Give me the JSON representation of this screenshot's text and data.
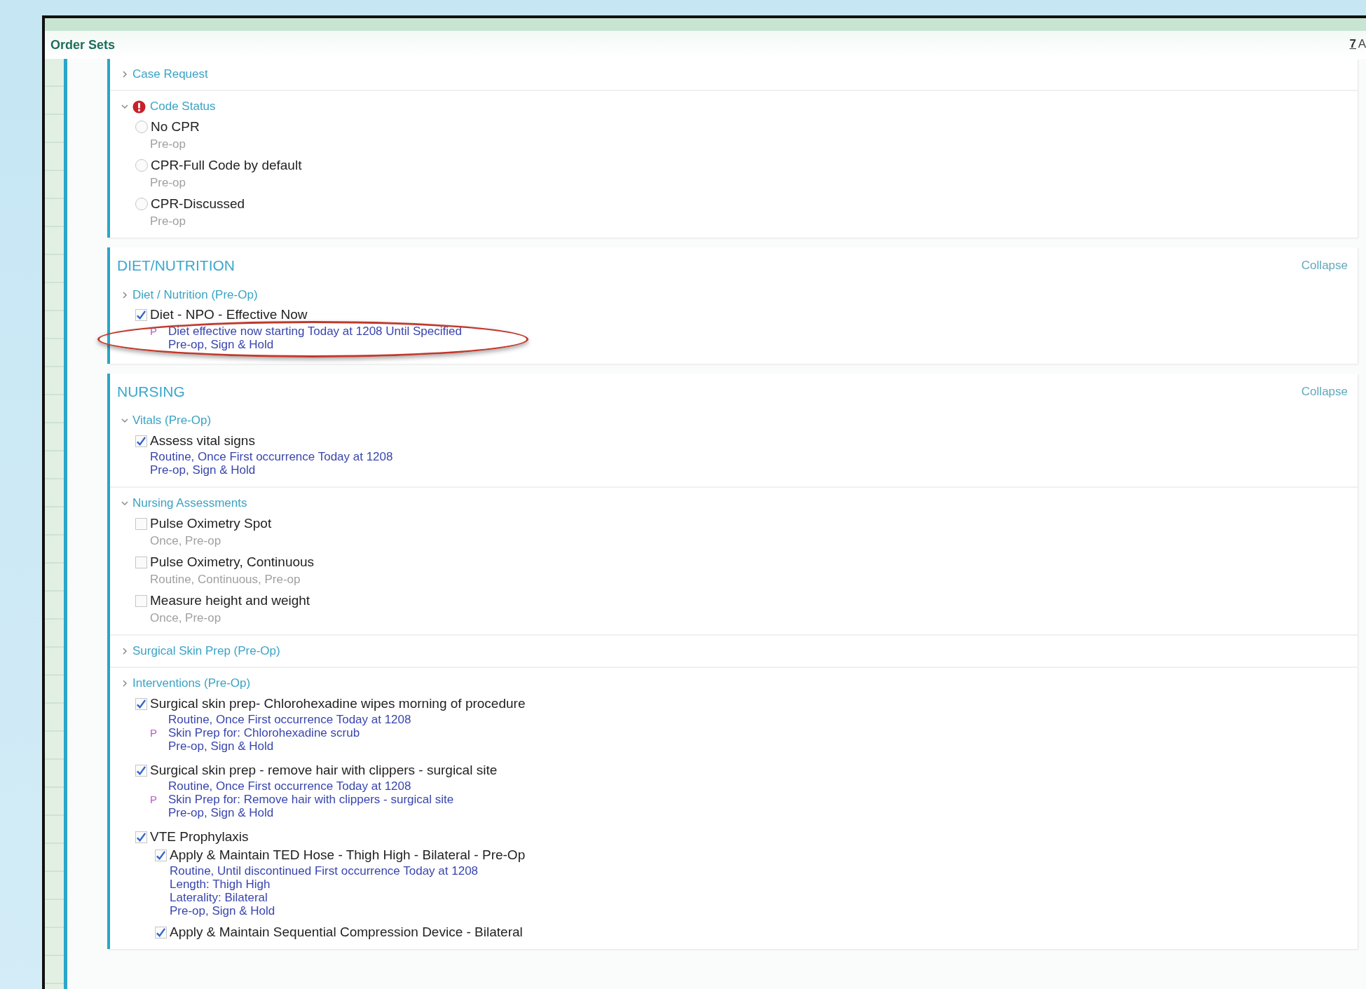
{
  "window": {
    "title": "Order Sets",
    "help": "7",
    "cut_label": "A"
  },
  "sections": [
    {
      "groups": [
        {
          "title": "Case Request",
          "expanded": false
        },
        {
          "title": "Code Status",
          "expanded": true,
          "alert": true,
          "items": [
            {
              "kind": "radio",
              "label": "No CPR",
              "selected": false,
              "details": [
                {
                  "text": "Pre-op"
                }
              ]
            },
            {
              "kind": "radio",
              "label": "CPR-Full Code by default",
              "selected": false,
              "details": [
                {
                  "text": "Pre-op"
                }
              ]
            },
            {
              "kind": "radio",
              "label": "CPR-Discussed",
              "selected": false,
              "details": [
                {
                  "text": "Pre-op"
                }
              ]
            }
          ]
        }
      ]
    },
    {
      "title": "DIET/NUTRITION",
      "collapse": "Collapse",
      "groups": [
        {
          "title": "Diet / Nutrition (Pre-Op)",
          "expanded": false,
          "items": [
            {
              "kind": "checkbox",
              "label": "Diet - NPO - Effective Now",
              "checked": true,
              "highlighted": true,
              "details": [
                {
                  "text": "Diet effective now starting Today at 1208 Until Specified",
                  "flag": "P"
                },
                {
                  "text": "Pre-op, Sign & Hold"
                }
              ]
            }
          ]
        }
      ]
    },
    {
      "title": "NURSING",
      "collapse": "Collapse",
      "groups": [
        {
          "title": "Vitals (Pre-Op)",
          "expanded": true,
          "items": [
            {
              "kind": "checkbox",
              "label": "Assess vital signs",
              "checked": true,
              "details": [
                {
                  "text": "Routine, Once First occurrence Today at 1208"
                },
                {
                  "text": "Pre-op, Sign & Hold"
                }
              ]
            }
          ]
        },
        {
          "title": "Nursing Assessments",
          "expanded": true,
          "items": [
            {
              "kind": "checkbox",
              "label": "Pulse Oximetry Spot",
              "checked": false,
              "details": [
                {
                  "text": "Once, Pre-op"
                }
              ]
            },
            {
              "kind": "checkbox",
              "label": "Pulse Oximetry, Continuous",
              "checked": false,
              "details": [
                {
                  "text": "Routine, Continuous, Pre-op"
                }
              ]
            },
            {
              "kind": "checkbox",
              "label": "Measure height and weight",
              "checked": false,
              "details": [
                {
                  "text": "Once, Pre-op"
                }
              ]
            }
          ]
        },
        {
          "title": "Surgical Skin Prep (Pre-Op)",
          "expanded": false
        },
        {
          "title": "Interventions (Pre-Op)",
          "expanded": false,
          "items": [
            {
              "kind": "checkbox",
              "label": "Surgical skin prep- Chlorohexadine wipes morning of procedure",
              "checked": true,
              "details": [
                {
                  "text": "Routine, Once First occurrence Today at 1208"
                },
                {
                  "text": "Skin Prep for: Chlorohexadine scrub",
                  "flag": "P"
                },
                {
                  "text": "Pre-op, Sign & Hold"
                }
              ]
            },
            {
              "kind": "checkbox",
              "label": "Surgical skin prep - remove hair with clippers - surgical site",
              "checked": true,
              "details": [
                {
                  "text": "Routine, Once First occurrence Today at 1208"
                },
                {
                  "text": "Skin Prep for: Remove hair with clippers - surgical site",
                  "flag": "P"
                },
                {
                  "text": "Pre-op, Sign & Hold"
                }
              ]
            },
            {
              "kind": "checkbox",
              "label": "VTE Prophylaxis",
              "checked": true,
              "children": [
                {
                  "kind": "checkbox",
                  "label": "Apply & Maintain TED Hose - Thigh High - Bilateral - Pre-Op",
                  "checked": true,
                  "details": [
                    {
                      "text": "Routine, Until discontinued First occurrence Today at 1208"
                    },
                    {
                      "text": "Length: Thigh High"
                    },
                    {
                      "text": "Laterality: Bilateral"
                    },
                    {
                      "text": "Pre-op, Sign & Hold"
                    }
                  ]
                },
                {
                  "kind": "checkbox",
                  "label": "Apply & Maintain Sequential Compression Device - Bilateral",
                  "checked": true
                }
              ]
            }
          ]
        }
      ]
    }
  ]
}
